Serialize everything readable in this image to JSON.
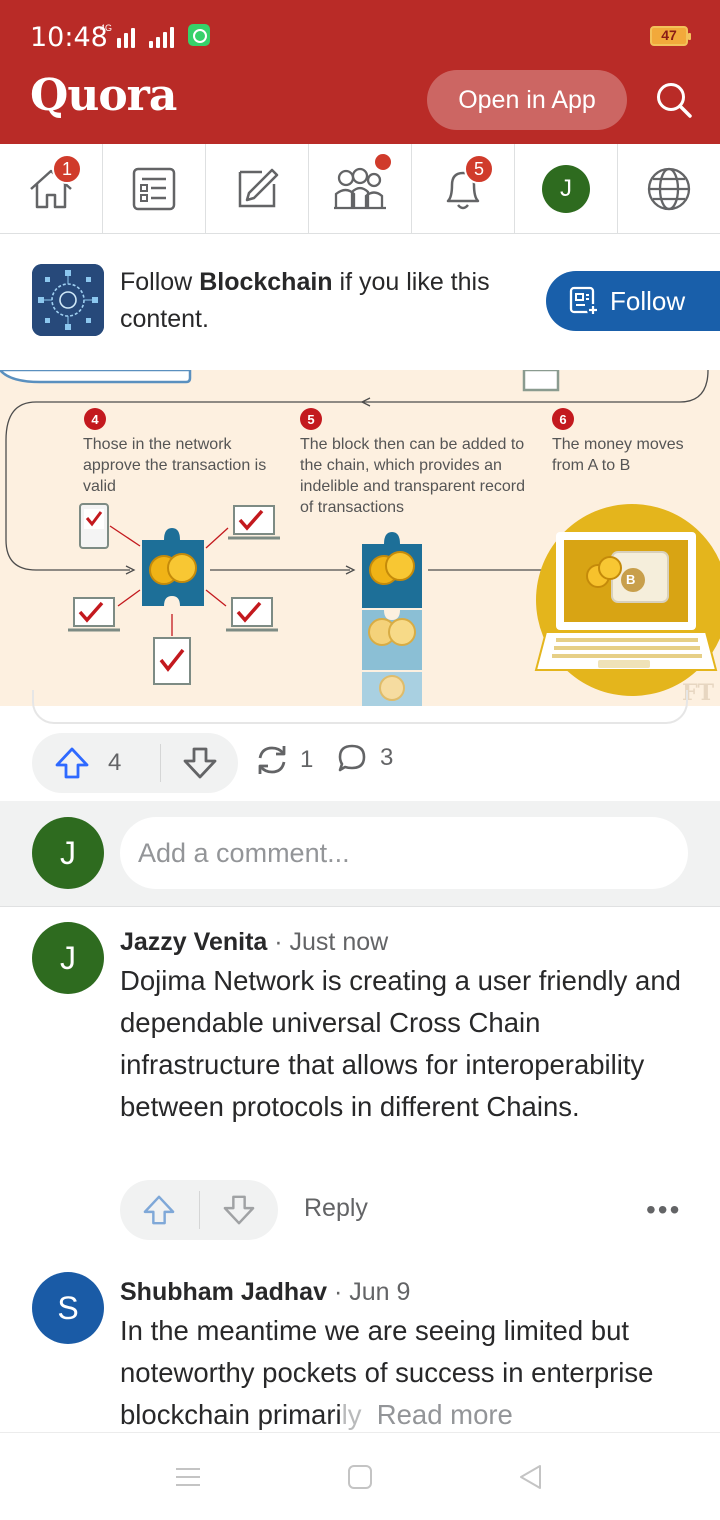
{
  "status_bar": {
    "time": "10:48",
    "network": "4G",
    "battery": "47"
  },
  "header": {
    "logo": "Quora",
    "open_app_label": "Open in App",
    "brand_color": "#b92b27"
  },
  "nav": {
    "items": [
      {
        "name": "home",
        "icon": "home-icon",
        "badge": "1"
      },
      {
        "name": "answer",
        "icon": "list-icon",
        "badge": ""
      },
      {
        "name": "write",
        "icon": "pencil-icon",
        "badge": ""
      },
      {
        "name": "spaces",
        "icon": "people-icon",
        "badge": "dot"
      },
      {
        "name": "notifications",
        "icon": "bell-icon",
        "badge": "5"
      },
      {
        "name": "profile",
        "icon": "avatar",
        "badge": "",
        "avatar_letter": "J"
      },
      {
        "name": "language",
        "icon": "globe-icon",
        "badge": ""
      }
    ]
  },
  "follow_banner": {
    "prefix": "Follow ",
    "topic": "Blockchain",
    "suffix": " if you like this content.",
    "button_label": "Follow"
  },
  "infographic": {
    "steps": [
      {
        "num": "4",
        "text": "Those in the network approve the transaction is valid"
      },
      {
        "num": "5",
        "text": "The block then can be added to the chain, which provides an indelible and transparent record of transactions"
      },
      {
        "num": "6",
        "text": "The money moves from A to B"
      }
    ],
    "coin_letter": "B",
    "watermark": "FT"
  },
  "actions": {
    "upvotes": "4",
    "shares": "1",
    "comments": "3"
  },
  "comment_box": {
    "avatar_letter": "J",
    "placeholder": "Add a comment..."
  },
  "comments": [
    {
      "avatar_letter": "J",
      "avatar_color": "#2e6b1f",
      "author": "Jazzy Venita",
      "time": " · Just now",
      "text": "Dojima Network is creating a user friendly and dependable universal Cross Chain infrastructure that allows for interoperability between protocols in different Chains.",
      "reply_label": "Reply",
      "more_label": "•••"
    },
    {
      "avatar_letter": "S",
      "avatar_color": "#1a5ba6",
      "author": "Shubham Jadhav",
      "time": " · Jun 9",
      "text_visible": "In the meantime we are seeing limited but noteworthy pockets of success in enterprise blockchain primari",
      "text_fade": "ly",
      "read_more": "Read more"
    }
  ]
}
